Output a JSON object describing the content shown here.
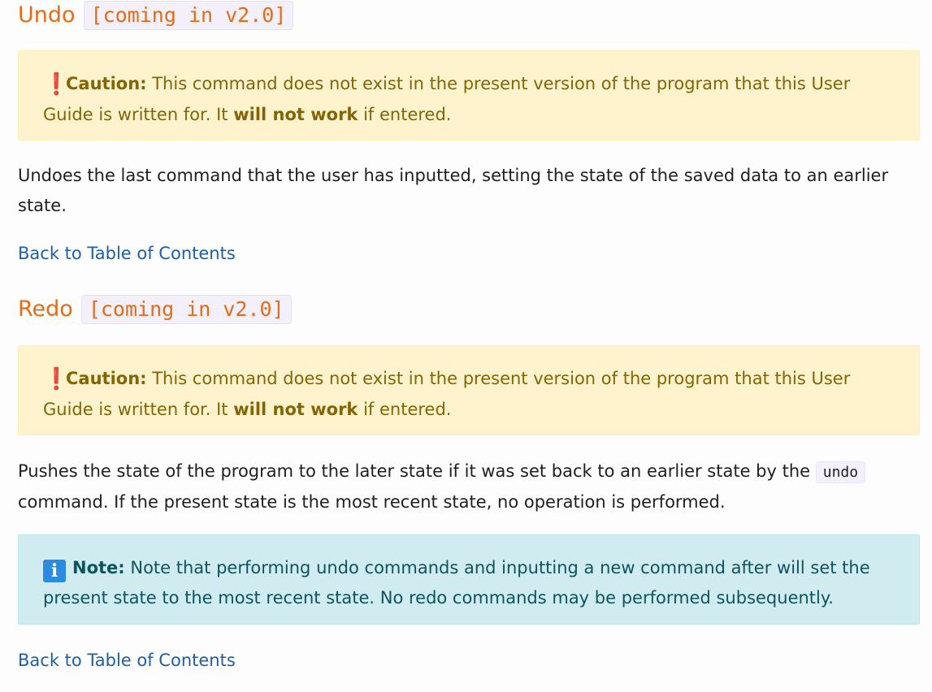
{
  "sections": [
    {
      "title": "Undo",
      "badge": "[coming in v2.0]",
      "caution": {
        "label": "Caution:",
        "text_before": " This command does not exist in the present version of the program that this User Guide is written for. It ",
        "bold": "will not work",
        "text_after": " if entered."
      },
      "description": "Undoes the last command that the user has inputted, setting the state of the saved data to an earlier state.",
      "back_link": "Back to Table of Contents"
    },
    {
      "title": "Redo",
      "badge": "[coming in v2.0]",
      "caution": {
        "label": "Caution:",
        "text_before": " This command does not exist in the present version of the program that this User Guide is written for. It ",
        "bold": "will not work",
        "text_after": " if entered."
      },
      "description_before": "Pushes the state of the program to the later state if it was set back to an earlier state by the ",
      "description_code": "undo",
      "description_after": " command. If the present state is the most recent state, no operation is performed.",
      "note": {
        "label": "Note:",
        "text": " Note that performing undo commands and inputting a new command after will set the present state to the most recent state. No redo commands may be performed subsequently."
      },
      "back_link": "Back to Table of Contents"
    }
  ],
  "icons": {
    "caution_glyph": "❗",
    "info_glyph": "i"
  },
  "colors": {
    "heading": "#e36c17",
    "link": "#1f5fa6",
    "warning_bg": "#fff3cd",
    "info_bg": "#d1ecf1"
  }
}
